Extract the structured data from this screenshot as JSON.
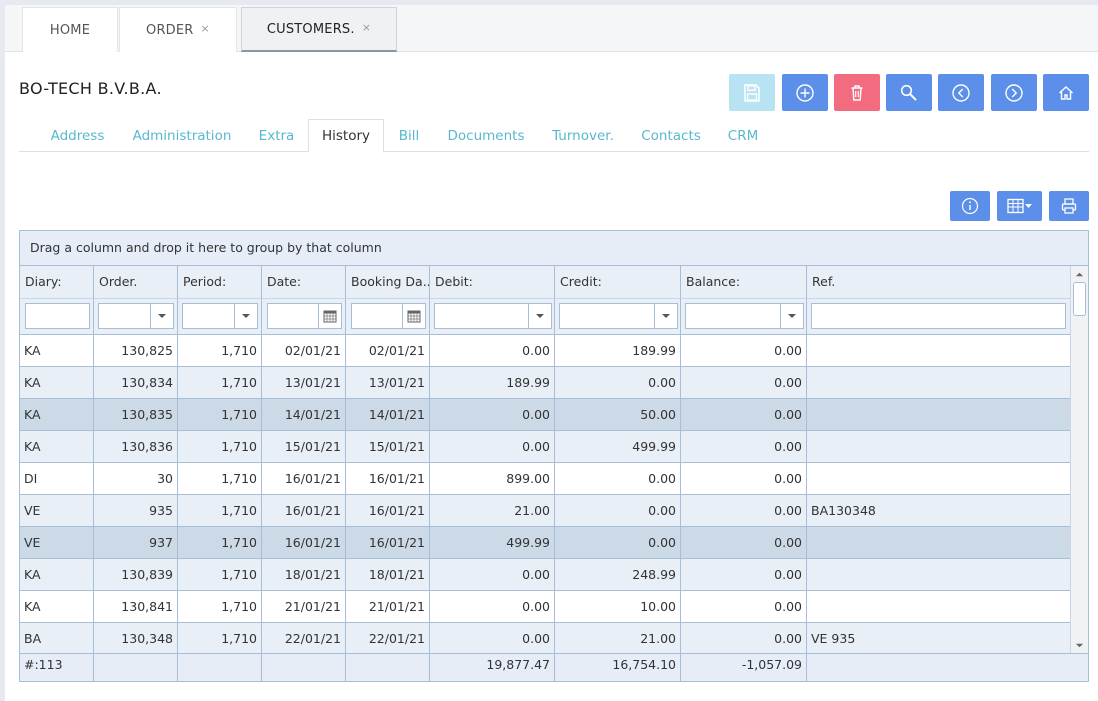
{
  "top_tabs": [
    {
      "label": "HOME",
      "closable": false
    },
    {
      "label": "ORDER",
      "closable": true
    },
    {
      "label": "CUSTOMERS.",
      "closable": true,
      "active": true
    }
  ],
  "close_glyph": "×",
  "company_name": "BO-TECH B.V.B.A.",
  "toolbar": {
    "icons": [
      "save-icon",
      "plus-circle-icon",
      "trash-icon",
      "search-icon",
      "chevron-left-circle-icon",
      "chevron-right-circle-icon",
      "home-icon"
    ],
    "colors": {
      "primary": "#5b8fe9",
      "save_disabled": "#b7e3f3",
      "delete": "#f36b7f"
    }
  },
  "sub_tabs": [
    {
      "label": "Address"
    },
    {
      "label": "Administration"
    },
    {
      "label": "Extra"
    },
    {
      "label": "History",
      "active": true
    },
    {
      "label": "Bill"
    },
    {
      "label": "Documents"
    },
    {
      "label": "Turnover."
    },
    {
      "label": "Contacts"
    },
    {
      "label": "CRM"
    }
  ],
  "grid_toolbar": {
    "icons": [
      "info-icon",
      "column-chooser-icon",
      "print-icon"
    ]
  },
  "grid": {
    "group_panel_text": "Drag a column and drop it here to group by that column",
    "columns": [
      "Diary:",
      "Order.",
      "Period:",
      "Date:",
      "Booking Da...",
      "Debit:",
      "Credit:",
      "Balance:",
      "Ref."
    ],
    "rows": [
      [
        "KA",
        "130,825",
        "1,710",
        "02/01/21",
        "02/01/21",
        "0.00",
        "189.99",
        "0.00",
        ""
      ],
      [
        "KA",
        "130,834",
        "1,710",
        "13/01/21",
        "13/01/21",
        "189.99",
        "0.00",
        "0.00",
        ""
      ],
      [
        "KA",
        "130,835",
        "1,710",
        "14/01/21",
        "14/01/21",
        "0.00",
        "50.00",
        "0.00",
        ""
      ],
      [
        "KA",
        "130,836",
        "1,710",
        "15/01/21",
        "15/01/21",
        "0.00",
        "499.99",
        "0.00",
        ""
      ],
      [
        "DI",
        "30",
        "1,710",
        "16/01/21",
        "16/01/21",
        "899.00",
        "0.00",
        "0.00",
        ""
      ],
      [
        "VE",
        "935",
        "1,710",
        "16/01/21",
        "16/01/21",
        "21.00",
        "0.00",
        "0.00",
        "BA130348"
      ],
      [
        "VE",
        "937",
        "1,710",
        "16/01/21",
        "16/01/21",
        "499.99",
        "0.00",
        "0.00",
        ""
      ],
      [
        "KA",
        "130,839",
        "1,710",
        "18/01/21",
        "18/01/21",
        "0.00",
        "248.99",
        "0.00",
        ""
      ],
      [
        "KA",
        "130,841",
        "1,710",
        "21/01/21",
        "21/01/21",
        "0.00",
        "10.00",
        "0.00",
        ""
      ],
      [
        "BA",
        "130,348",
        "1,710",
        "22/01/21",
        "22/01/21",
        "0.00",
        "21.00",
        "0.00",
        "VE 935"
      ]
    ],
    "selected_rows": [
      2,
      6
    ],
    "footer": [
      "#:113",
      "",
      "",
      "",
      "",
      "19,877.47",
      "16,754.10",
      "-1,057.09",
      ""
    ]
  }
}
